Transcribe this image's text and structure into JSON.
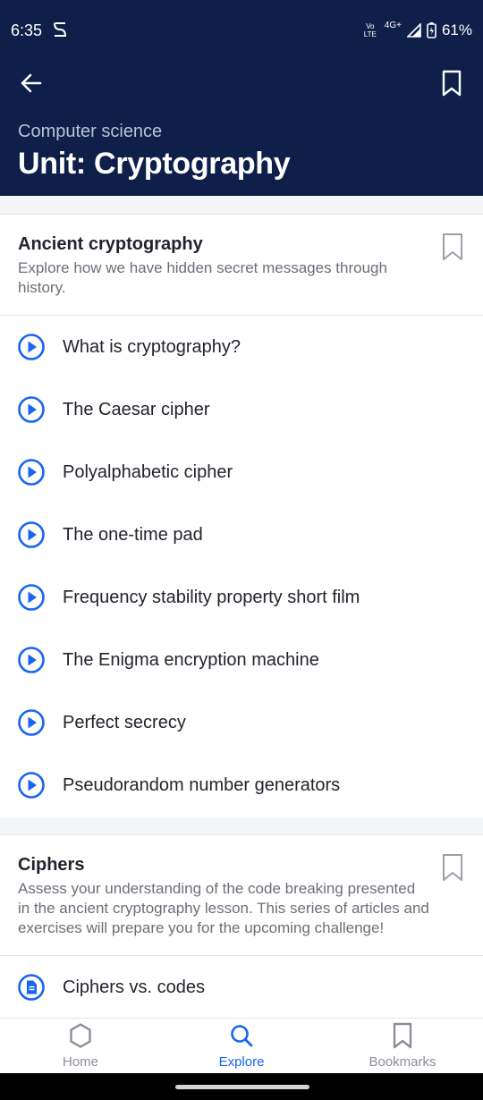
{
  "status_bar": {
    "time": "6:35",
    "network_label": "Vo LTE",
    "network_type": "4G+",
    "battery": "61%"
  },
  "header": {
    "subject": "Computer science",
    "title": "Unit: Cryptography"
  },
  "sections": [
    {
      "title": "Ancient cryptography",
      "description": "Explore how we have hidden secret messages through history.",
      "items": [
        {
          "label": "What is cryptography?",
          "icon": "play-icon"
        },
        {
          "label": "The Caesar cipher",
          "icon": "play-icon"
        },
        {
          "label": "Polyalphabetic cipher",
          "icon": "play-icon"
        },
        {
          "label": "The one-time pad",
          "icon": "play-icon"
        },
        {
          "label": "Frequency stability property short film",
          "icon": "play-icon"
        },
        {
          "label": "The Enigma encryption machine",
          "icon": "play-icon"
        },
        {
          "label": "Perfect secrecy",
          "icon": "play-icon"
        },
        {
          "label": "Pseudorandom number generators",
          "icon": "play-icon"
        }
      ]
    },
    {
      "title": "Ciphers",
      "description": "Assess your understanding of the code breaking presented in the ancient cryptography lesson. This series of articles and exercises will prepare you for the upcoming challenge!",
      "items": [
        {
          "label": "Ciphers vs. codes",
          "icon": "article-icon"
        }
      ]
    }
  ],
  "bottom_nav": [
    {
      "label": "Home",
      "icon": "hexagon-home-icon",
      "active": false
    },
    {
      "label": "Explore",
      "icon": "search-icon",
      "active": true
    },
    {
      "label": "Bookmarks",
      "icon": "bookmark-icon",
      "active": false
    }
  ],
  "colors": {
    "header_bg": "#0e2049",
    "accent": "#1865f2",
    "text": "#21242c",
    "muted": "#6b6f78"
  }
}
